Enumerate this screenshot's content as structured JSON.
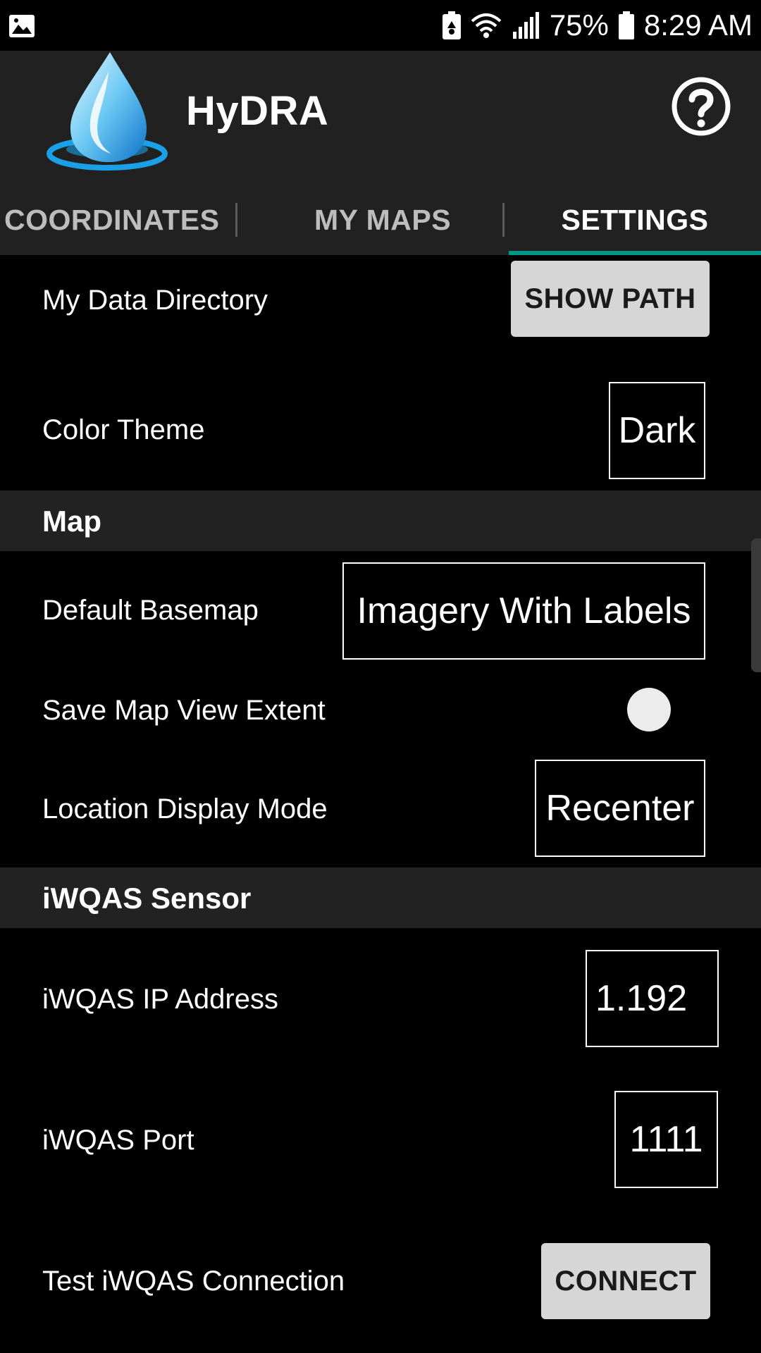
{
  "status_bar": {
    "battery_percent": "75%",
    "time": "8:29 AM",
    "icons": [
      "image-icon",
      "battery-saver-icon",
      "wifi-icon",
      "signal-icon",
      "battery-icon"
    ]
  },
  "header": {
    "title": "HyDRA",
    "logo_icon": "water-drop-icon",
    "help_icon": "help-circle-icon"
  },
  "tabs": [
    {
      "label": "COORDINATES",
      "active": false
    },
    {
      "label": "MY MAPS",
      "active": false
    },
    {
      "label": "SETTINGS",
      "active": true
    }
  ],
  "settings": {
    "data_directory": {
      "label": "My Data Directory",
      "button": "SHOW PATH"
    },
    "color_theme": {
      "label": "Color Theme",
      "value": "Dark"
    },
    "map_section": {
      "title": "Map"
    },
    "default_basemap": {
      "label": "Default Basemap",
      "value": "Imagery With Labels"
    },
    "save_map_view_extent": {
      "label": "Save Map View Extent",
      "enabled": false
    },
    "location_display_mode": {
      "label": "Location Display Mode",
      "value": "Recenter"
    },
    "sensor_section": {
      "title": "iWQAS Sensor"
    },
    "ip_address": {
      "label": "iWQAS IP Address",
      "value": "1.192"
    },
    "port": {
      "label": "iWQAS Port",
      "value": "1111"
    },
    "test_connection": {
      "label": "Test iWQAS Connection",
      "button": "CONNECT"
    }
  },
  "colors": {
    "accent": "#009688",
    "header_bg": "#212121",
    "section_bg": "#222222",
    "background": "#000000",
    "button_bg": "#d6d6d6"
  }
}
